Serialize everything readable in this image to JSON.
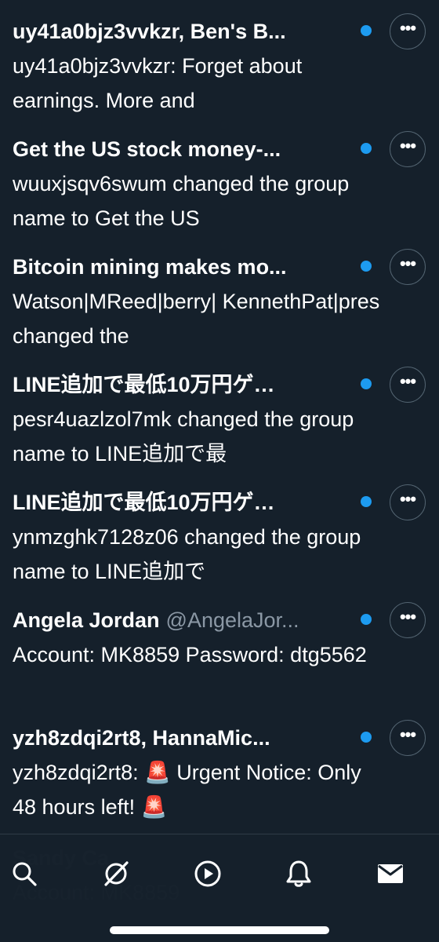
{
  "conversations": [
    {
      "title": "uy41a0bjz3vvkzr, Ben's B...",
      "handle": "",
      "preview": "uy41a0bjz3vvkzr: Forget about earnings. More and",
      "unread": true,
      "more_label": "•••"
    },
    {
      "title": "Get the US stock money-...",
      "handle": "",
      "preview": "wuuxjsqv6swum changed the group name to Get the US",
      "unread": true,
      "more_label": "•••"
    },
    {
      "title": "Bitcoin mining makes mo...",
      "handle": "",
      "preview": "Watson|MReed|berry| KennethPat|pres changed the",
      "unread": true,
      "more_label": "•••"
    },
    {
      "title": "LINE追加で最低10万円ゲ…",
      "handle": "",
      "preview": "pesr4uazlzol7mk changed the group name to LINE追加で最",
      "unread": true,
      "more_label": "•••"
    },
    {
      "title": "LINE追加で最低10万円ゲ…",
      "handle": "",
      "preview": "ynmzghk7128z06 changed the group name to LINE追加で",
      "unread": true,
      "more_label": "•••"
    },
    {
      "title": "Angela Jordan",
      "handle": "@AngelaJor...",
      "preview": "Account: MK8859 Password: dtg5562",
      "unread": true,
      "more_label": "•••"
    },
    {
      "title": "yzh8zdqi2rt8, HannaMic...",
      "handle": "",
      "preview": "yzh8zdqi2rt8: 🚨 Urgent Notice: Only 48 hours left! 🚨",
      "unread": true,
      "more_label": "•••"
    }
  ],
  "nav": {
    "items": [
      {
        "name": "search",
        "icon": "search-icon",
        "active": false
      },
      {
        "name": "grok",
        "icon": "grok-icon",
        "active": false
      },
      {
        "name": "video",
        "icon": "play-icon",
        "active": false
      },
      {
        "name": "notifications",
        "icon": "bell-icon",
        "active": false
      },
      {
        "name": "messages",
        "icon": "mail-icon",
        "active": true
      }
    ]
  },
  "ghost_behind_nav": {
    "line1": "Sandy Ca...",
    "line2": "Account: MK8859"
  },
  "colors": {
    "background": "#15202b",
    "unread_dot": "#1d9bf0",
    "handle_gray": "#8b98a5",
    "text": "#ffffff"
  }
}
